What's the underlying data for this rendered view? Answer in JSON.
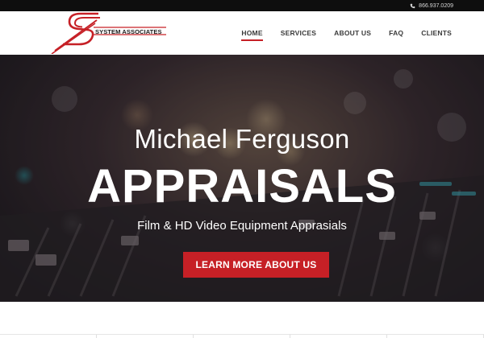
{
  "topbar": {
    "phone": "866.937.0209",
    "phone_icon": "phone-icon"
  },
  "logo": {
    "text": "SYSTEM ASSOCIATES",
    "brand_color": "#c62026"
  },
  "nav": {
    "items": [
      {
        "label": "HOME",
        "active": true
      },
      {
        "label": "SERVICES",
        "active": false
      },
      {
        "label": "ABOUT US",
        "active": false
      },
      {
        "label": "FAQ",
        "active": false
      },
      {
        "label": "CLIENTS",
        "active": false
      }
    ],
    "accent": "#c62026"
  },
  "hero": {
    "subtitle": "Michael Ferguson",
    "title": "APPRAISALS",
    "tagline": "Film & HD Video Equipment Apprasials",
    "cta": "LEARN MORE ABOUT US"
  }
}
